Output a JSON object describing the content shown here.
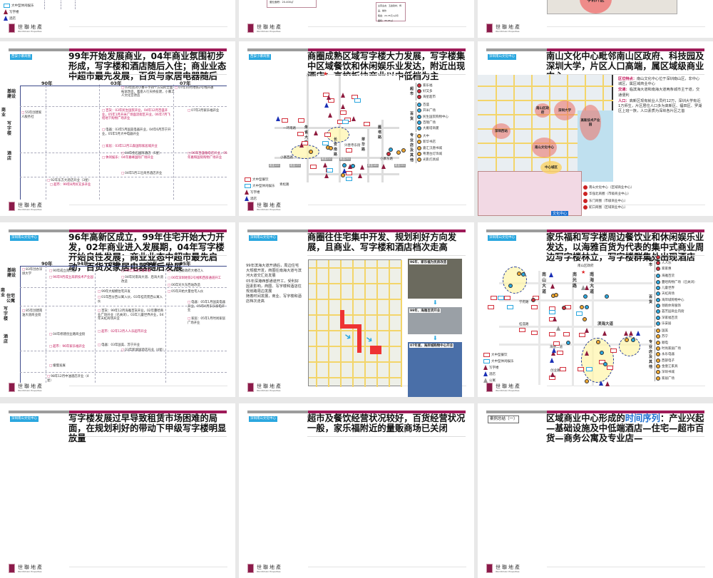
{
  "brand": {
    "name": "世聯地產",
    "sub": "WorldUnion Properties"
  },
  "s0": {
    "legend": [
      "大中型休闲娱乐",
      "写字楼",
      "酒店"
    ]
  },
  "s1": {
    "info": [
      "主营业态：五金建材、饰品、餐饮",
      "租金：20-35元/㎡/月",
      "面积：35-65㎡"
    ],
    "info2": "营业面积：20-400㎡"
  },
  "s2": {
    "zone": "学府片区"
  },
  "s3": {
    "tag": "西安小寨商圈",
    "title": "99年开始发展商业，04年商业氛围初步形成，写字楼和酒店随后入住；商业业态中超市最先发展，百货与家居电器随后",
    "years": [
      "90年",
      "03年",
      "07年"
    ],
    "rows": [
      "基础建设",
      "商业",
      "写字楼",
      "酒店"
    ],
    "notes": [
      "03年底对小寨十字四个方向的全面拓宽改造，着座人行天桥投建，小寨工人文化宫改造",
      "07年10月地铁2号线开通",
      "55年创建家人服务社",
      "百货：03年民生国贸开业，04年12月百盛开业，05年1月开米广场面流街区开业，06年7月飞绍地下购物广场开业",
      "电器：03年5月国美电器开业，04年6月苏宁开业，05年5月大中电器开业",
      "家居：03年12月三森国际家居城开业",
      "04年金石国际酒店（5星）",
      "休闲娱乐：04年嘉峰国际广场开业",
      "04年5月三壮商务酒店开业",
      "07年2月家乐福开业",
      "06年百盛雁塔店开业，05年嘉和国际购物广场开业",
      "92年东方大酒店开业（3星）",
      "超市：99年8月好又多开业"
    ]
  },
  "s4": {
    "tag": "西安小寨商圈",
    "title": "商圈成熟区域写字楼大力发展，写字楼集中区域餐饮和休闲娱乐业发达，附近出现酒店；高校板块商业以中低档为主",
    "roads": [
      "市政府",
      "一环南路",
      "朱雀大街",
      "长安南路",
      "兴善寺东街",
      "翠华路",
      "雁塔路",
      "小寨西路",
      "小寨东路",
      "青松路"
    ],
    "prices": [
      "租金120",
      "租金170",
      "租金210",
      "租金250",
      "租金180",
      "租金150"
    ],
    "legend": {
      "cats": [
        {
          "name": "超市",
          "items": [
            "家乐福",
            "好又多",
            "海星超市"
          ]
        },
        {
          "name": "百货",
          "items": [
            "百盛",
            "开米广场",
            "民生国贸购物中心",
            "百隆广场",
            "大雁塔商厦"
          ]
        },
        {
          "name": "专业店及其他",
          "items": [
            "大中",
            "新华书店",
            "嘉汇汉唐书城",
            "粤港台灯饰城",
            "光影灯具城"
          ]
        }
      ],
      "types": [
        "大中型餐饮",
        "大中型休闲娱乐",
        "写字楼",
        "酒店"
      ]
    }
  },
  "s5": {
    "tag": "深圳南山文化中心",
    "title": "南山文化中心毗邻南山区政府、科技园及深圳大学，片区人口高端，属区域级商业中心",
    "bubbles": [
      "南山区政府",
      "深圳大学",
      "高新技术产业园",
      "深圳西站",
      "南山文化中心",
      "中心城区"
    ],
    "bullets": [
      {
        "k": "区位特点：",
        "v": "南山文化中心位于深圳南山区，非中心城区，属区域商业中心"
      },
      {
        "k": "交通：",
        "v": "临滨海大道和南海大道两条城市主干道，交通便利"
      },
      {
        "k": "人口：",
        "v": "高新区现有就业人员约12万，深圳大学有近1万师生，片区居住人口多为高新区、福田区、罗湖区上班一族，人口素质为深圳各片区之首"
      }
    ],
    "legend": [
      "南山文化中心（区域商业中心）",
      "华强北商圈（市级商业中心）",
      "东门商圈（市级商业中心）",
      "蛇口商圈（区域商业中心）"
    ],
    "bottom_label": "文化中心"
  },
  "s6": {
    "tag": "深圳南山文化中心",
    "title": "96年高新区成立，99年住宅开始大力开发，02年商业进入发展期，04年写字楼开始良性发展；商业业态中超市最先启动，百货及家居电器随后发展",
    "years": [
      "90年",
      "94年",
      "99年",
      "02年",
      "05年"
    ],
    "rows": [
      "基础建设",
      "住宅公寓",
      "商业",
      "写字楼",
      "酒店"
    ],
    "notes": [
      "83年创办深圳大学",
      "90年成立南山区",
      "96年9月成立高新技术产业园",
      "99年滨海大道开通",
      "04年对南海大道、后海大道改造",
      "05年区委政府大楼迁入",
      "06年深圳地铁2号线和西部通道开工",
      "06年对大东西站改造",
      "99年大规模住宅开发",
      "01年西分西公寓入伙，03年桂花苑西公寓入伙",
      "05年开始大量住宅入伙",
      "85年创建南油大道商业街",
      "百货：99年12月海雅百货开业，02年蔓哈商业广场开业（已关闭），03年儿童世界开业，04年天虹商场开业",
      "超市：02年12月人人乐超市开业",
      "电器：03年国美、苏宁开业",
      "04年修建创业路商业街",
      "超市：96年家乐福开业",
      "03年新城国酒店开业（4星）",
      "电器：05年1月国美电器开业，05年4月东乐家电开业",
      "家居：05年1月时尚家居广场开业",
      "缓慢发展",
      "98年12月中油酒店开业（4星）"
    ]
  },
  "s7": {
    "tag": "深圳南山文化中心",
    "title": "商圈往住宅集中开发、规划利好方向发展，且商业、写字楼和酒店档次走高",
    "bullets": [
      "99年滨海大道开通后，周边住宅大规模开发，商圈往南海大道与滨河大道交汇处发展",
      "05年深港西部通道开工，受利好因素影响，商圈、写字楼和酒店往规划路周边发展",
      "随着时间发展，商业、写字楼和酒店档次走高"
    ],
    "photos": [
      "96年，家乐福为民房改造",
      "99年，海雅百货开业",
      "07年底，海岸城购物中心开业"
    ]
  },
  "s8": {
    "tag": "深圳南山文化中心",
    "title": "家乐福和写字楼周边餐饮业和休闲娱乐业发达，以海雅百货为代表的集中式商业周边写字楼林立，写字楼群集处出现酒店",
    "roads": [
      "南山区政府",
      "南山大道",
      "南光路",
      "南海大道",
      "滨海大道",
      "学府路",
      "桂庙路",
      "海德二道",
      "创业路"
    ],
    "legend": {
      "cats": [
        {
          "name": "超市",
          "items": [
            "家乐福",
            "人人乐",
            "家家惠"
          ]
        },
        {
          "name": "百货",
          "items": [
            "海雅百货",
            "蔓哈购物广场（已关闭）",
            "儿童世界",
            "天虹商场",
            "海岸城购物中心",
            "领跑体育服饰",
            "荟芳园商业内街",
            "深家福百货",
            "乐安居"
          ]
        },
        {
          "name": "专业店及其他",
          "items": [
            "国美",
            "苏宁",
            "顺电",
            "时尚家居广场",
            "永乐电器",
            "西部电子",
            "金壹江家具",
            "深圳书城",
            "家居广场"
          ]
        }
      ],
      "types": [
        "大中型餐饮",
        "大中型休闲娱乐",
        "写字楼",
        "酒店",
        "公寓"
      ]
    }
  },
  "s9": {
    "tag": "深圳南山文化中心",
    "title": "写字楼发展过早导致租赁市场困难的局面，在规划利好的带动下甲级写字楼明显放量"
  },
  "s10": {
    "tag": "深圳南山文化中心",
    "title": "超市及餐饮经营状况较好，百货经营状况一般，家乐福附近的量贩商场已关闭"
  },
  "s11": {
    "tag": "案例总结（一）",
    "title_pre": "区域商业中心形成的",
    "title_hl": "时间序列",
    "title_post": "：产业兴起—基础设施及中低端酒店—住宅—超市百货—商务公寓及专业店—"
  }
}
